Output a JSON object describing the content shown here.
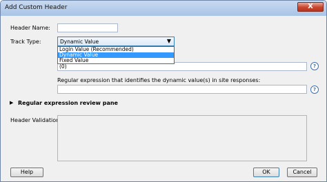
{
  "window": {
    "title": "Add Custom Header",
    "close_glyph": "X"
  },
  "form": {
    "header_name_label": "Header Name:",
    "header_name_value": "",
    "track_type_label": "Track Type:",
    "track_type_selected": "Dynamic Value",
    "track_type_options": [
      "Login Value (Recommended)",
      "Dynamic Value",
      "Fixed Value"
    ],
    "dynamic_value_field": "(0)",
    "regex_label": "Regular expression that identifies the dynamic value(s) in site responses:",
    "regex_value": "",
    "review_pane_label": "Regular expression review pane",
    "validation_label": "Header Validation:"
  },
  "icons": {
    "help": "?",
    "expander": "▶",
    "dropdown_arrow": "▼"
  },
  "buttons": {
    "help": "Help",
    "ok": "OK",
    "cancel": "Cancel"
  }
}
